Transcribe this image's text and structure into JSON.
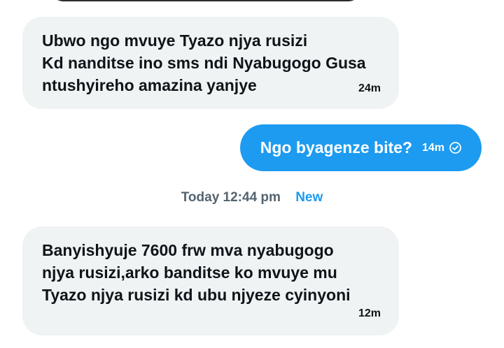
{
  "messages": [
    {
      "direction": "incoming",
      "text": "Ubwo ngo mvuye Tyazo njya rusizi\nKd nanditse ino sms ndi Nyabugogo Gusa\nntushyireho amazina yanjye",
      "time": "24m"
    },
    {
      "direction": "outgoing",
      "text": "Ngo byagenze bite?",
      "time": "14m",
      "status_icon": "sent-check-icon"
    },
    {
      "direction": "incoming",
      "text": "Banyishyuje 7600 frw mva nyabugogo\nnjya rusizi,arko banditse ko mvuye mu\nTyazo njya  rusizi kd ubu njyeze cyinyoni",
      "time": "12m"
    }
  ],
  "separator": {
    "timestamp": "Today 12:44 pm",
    "badge": "New"
  },
  "colors": {
    "incoming_bubble": "#eff3f4",
    "outgoing_bubble": "#1d9bf0",
    "accent": "#1d9bf0",
    "muted_text": "#536471"
  }
}
